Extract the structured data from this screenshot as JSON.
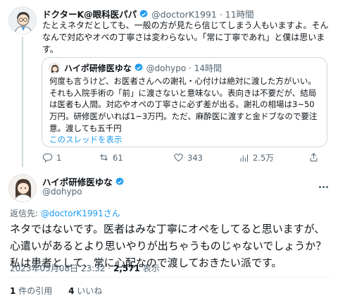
{
  "tweet1": {
    "name": "ドクターK@眼科医パパ",
    "handle": "@doctorK1991",
    "sep": "·",
    "time": "11時間",
    "text": "たとえネタだとしても、一般の方が見たら信じてしまう人もいますよ。そんなんで対応やオペの丁寧さは変わらない。「常に丁寧であれ」と僕は思います。",
    "quote": {
      "name": "ハイポ研修医ゆな",
      "handle": "@dohypo",
      "sep": "·",
      "time": "14時間",
      "text": "何度も言うけど、お医者さんへの謝礼・心付けは絶対に渡した方がいい。それも入院手術の「前」に渡さないと意味ない。表向きは不要だが、結局は医者も人間。対応やオペの丁寧さに必ず差が出る。謝礼の相場は3~50万円。研修医がいれば1~3万円。ただ、麻酔医に渡すと金ドブなので要注意。渡しても五千円",
      "show_thread": "このスレッドを表示"
    },
    "actions": {
      "reply_count": "1",
      "retweet_count": "61",
      "like_count": "343",
      "view_count": "2.5万"
    }
  },
  "tweet2": {
    "name": "ハイポ研修医ゆな",
    "handle": "@dohypo",
    "reply_prefix": "返信先: ",
    "reply_to": "@doctorK1991さん",
    "text": "ネタではないです。医者はみな丁寧にオペをしてると思いますが、心遣いがあるとより思いやりが出ちゃうものじゃないでしょうか？私は患者として、常に心配なので渡しておきたい派です。",
    "date": "2023年05月08日 23:32",
    "sep": " · ",
    "views": "2,571",
    "views_label": " 表示",
    "quotes_count": "1",
    "quotes_label": "件の引用",
    "likes_count": "4",
    "likes_label": "いいね"
  },
  "colors": {
    "accent": "#1d9bf0",
    "text": "#0f1419",
    "muted": "#536471",
    "border": "#cfd9de"
  }
}
